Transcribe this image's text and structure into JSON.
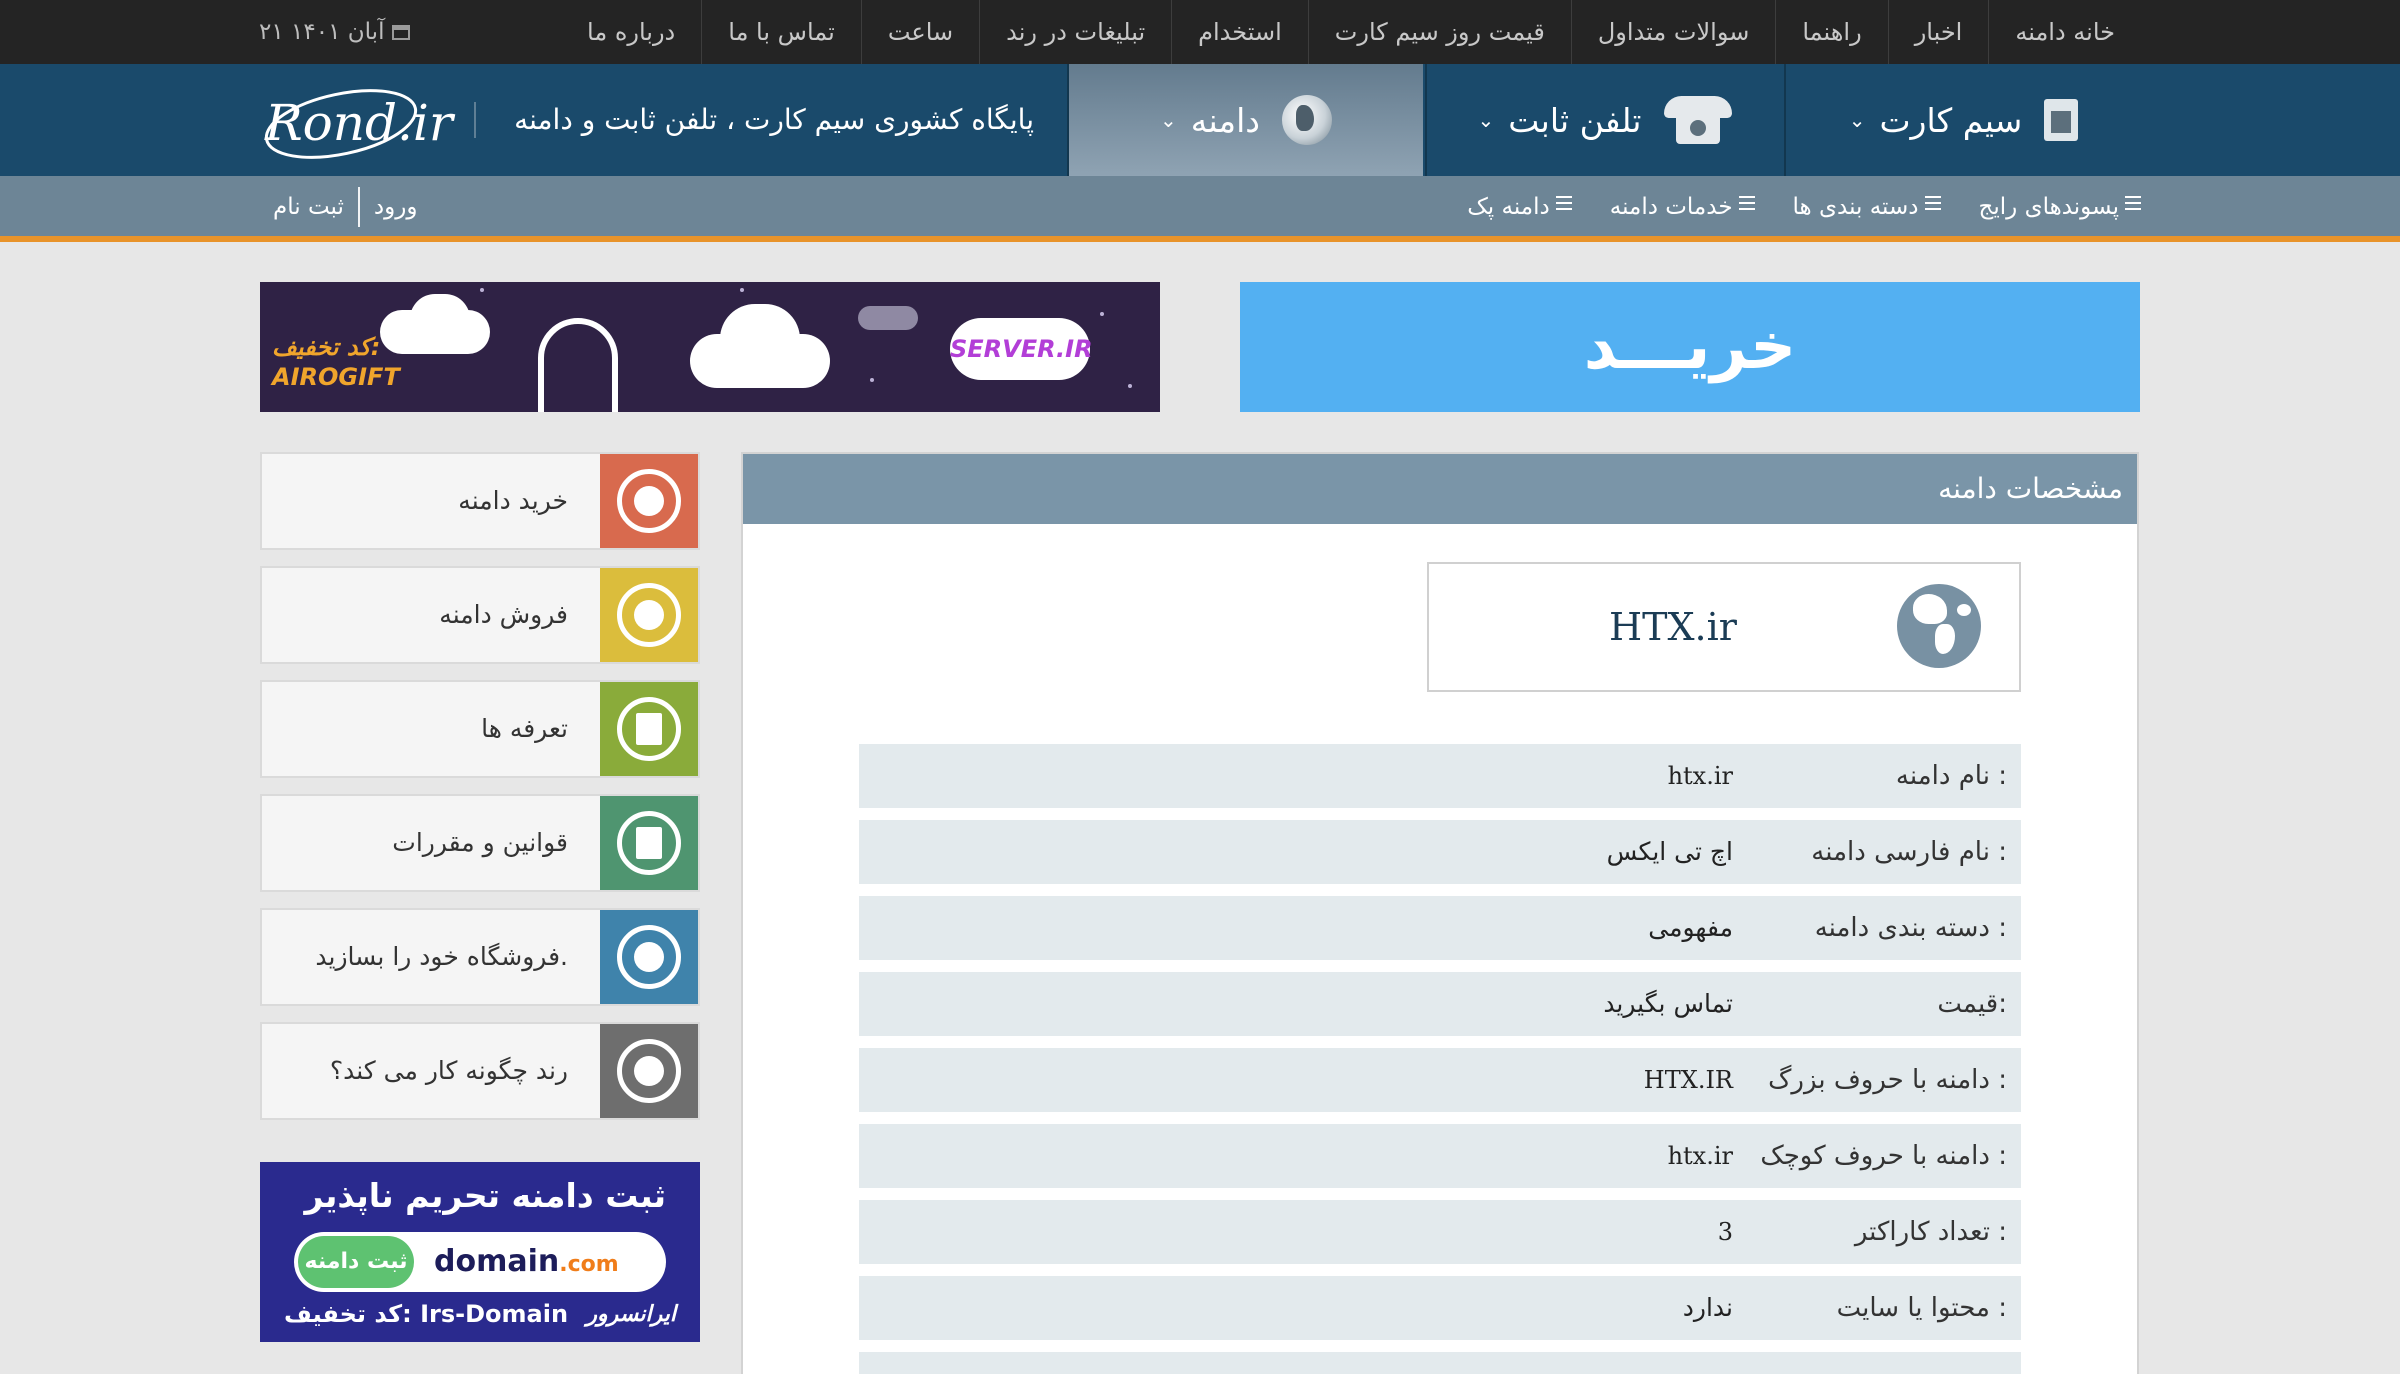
{
  "top_menu": [
    "خانه دامنه",
    "اخبار",
    "راهنما",
    "سوالات متداول",
    "قیمت روز سیم کارت",
    "استخدام",
    "تبلیغات در رند",
    "ساعت",
    "تماس با ما",
    "درباره ما"
  ],
  "date": "۲۱ آبان ۱۴۰۱",
  "header": {
    "nav": [
      {
        "label": "سیم کارت",
        "icon": "sim-card-icon"
      },
      {
        "label": "تلفن ثابت",
        "icon": "telephone-icon"
      },
      {
        "label": "دامنه",
        "icon": "globe-icon"
      }
    ],
    "tagline": "پایگاه کشوری سیم کارت ، تلفن ثابت و دامنه",
    "logo": "Rond.ir"
  },
  "sub_menu": [
    "پسوندهای رایج",
    "دسته بندی ها",
    "خدمات دامنه",
    "دامنه پک"
  ],
  "auth": {
    "login": "ورود",
    "register": "ثبت نام"
  },
  "banners": {
    "buy": "خریـــد",
    "server": {
      "badge": "SERVER.IR",
      "discount_label": "کد تخفیف:",
      "code": "AIROGIFT"
    },
    "irs": {
      "headline": "ثبت دامنه تحریم ناپذیر",
      "register_btn": "ثبت دامنه",
      "domain_main": "domain",
      "domain_ext": ".com",
      "code_line": "کد تخفیف: Irs-Domain",
      "brand": "ایرانسرور"
    }
  },
  "sidebar": [
    {
      "label": "خرید دامنه",
      "color": "#d86a4e",
      "icon": "globe-buy-icon"
    },
    {
      "label": "فروش دامنه",
      "color": "#dbbd3c",
      "icon": "globe-sell-icon"
    },
    {
      "label": "تعرفه ها",
      "color": "#8aab3a",
      "icon": "document-icon"
    },
    {
      "label": "قوانین و مقررات",
      "color": "#4f9570",
      "icon": "rules-document-icon"
    },
    {
      "label": "فروشگاه خود را بسازید.",
      "color": "#3f83ab",
      "icon": "web-globe-icon"
    },
    {
      "label": "رند چگونه کار می کند؟",
      "color": "#6e6e6e",
      "icon": "refresh-icon"
    }
  ],
  "panel": {
    "title": "مشخصات دامنه",
    "domain": "HTX.ir",
    "rows": [
      {
        "key": "نام دامنه :",
        "value": "htx.ir"
      },
      {
        "key": "نام فارسی دامنه :",
        "value": "اچ تی ایکس"
      },
      {
        "key": "دسته بندی دامنه :",
        "value": "مفهومی"
      },
      {
        "key": "قیمت:",
        "value": "تماس بگیرید"
      },
      {
        "key": "دامنه با حروف بزرگ :",
        "value": "HTX.IR"
      },
      {
        "key": "دامنه با حروف کوچک :",
        "value": "htx.ir"
      },
      {
        "key": "تعداد کاراکتر :",
        "value": "3"
      },
      {
        "key": "محتوا یا سایت :",
        "value": "ندارد"
      },
      {
        "key": "",
        "value": ""
      }
    ]
  }
}
